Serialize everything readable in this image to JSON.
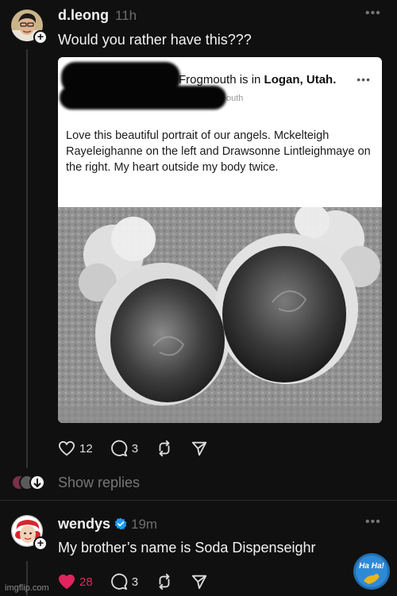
{
  "post1": {
    "username": "d.leong",
    "time": "11h",
    "text": "Would you rather have this???",
    "avatar_icon": "person-avatar",
    "embedded": {
      "location_prefix": "Frogmouth is in",
      "location": "Logan, Utah.",
      "subtitle": "outh",
      "caption": "Love this beautiful portrait of our angels. Mckelteigh Rayeleighanne on the left and Drawsonne Lintleighmaye on the right. My heart outside my body twice."
    },
    "likes": "12",
    "replies": "3"
  },
  "show_replies": "Show replies",
  "post2": {
    "username": "wendys",
    "verified_icon": "verified-badge-icon",
    "time": "19m",
    "text": "My brother’s name is Soda Dispenseighr",
    "likes": "28",
    "replies": "3",
    "like_color": "#e0245e"
  },
  "watermark": "imgflip.com",
  "sticker_text": "Ha Ha!"
}
